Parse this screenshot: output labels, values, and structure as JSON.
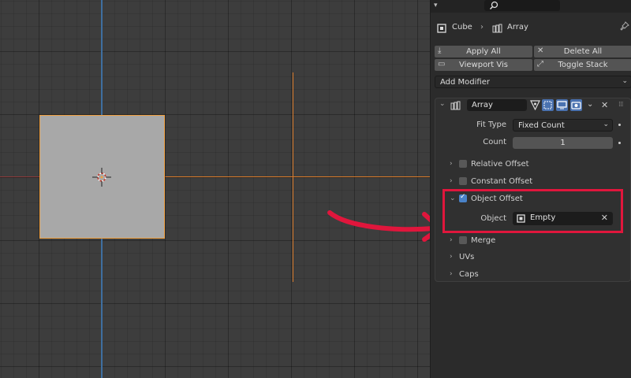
{
  "breadcrumb": {
    "object": "Cube",
    "modifier": "Array"
  },
  "toolbar": {
    "apply_all": "Apply All",
    "delete_all": "Delete All",
    "viewport_vis": "Viewport Vis",
    "toggle_stack": "Toggle Stack",
    "add_modifier": "Add Modifier"
  },
  "modifier": {
    "name": "Array",
    "fit_type_label": "Fit Type",
    "fit_type_value": "Fixed Count",
    "count_label": "Count",
    "count_value": "1",
    "sections": {
      "relative_offset": "Relative Offset",
      "constant_offset": "Constant Offset",
      "object_offset": "Object Offset",
      "merge": "Merge",
      "uvs": "UVs",
      "caps": "Caps"
    },
    "object_label": "Object",
    "object_value": "Empty",
    "object_offset_enabled": true
  },
  "colors": {
    "highlight": "#e0163c",
    "selection": "#f0a040",
    "toggle_active": "#4a72b0"
  },
  "icons": [
    "search-icon",
    "object-icon",
    "modifier-array-icon",
    "download-icon",
    "close-icon",
    "monitor-icon",
    "camera-icon",
    "pin-icon",
    "chevron-right-icon",
    "chevron-down-icon",
    "wrench-icon"
  ]
}
